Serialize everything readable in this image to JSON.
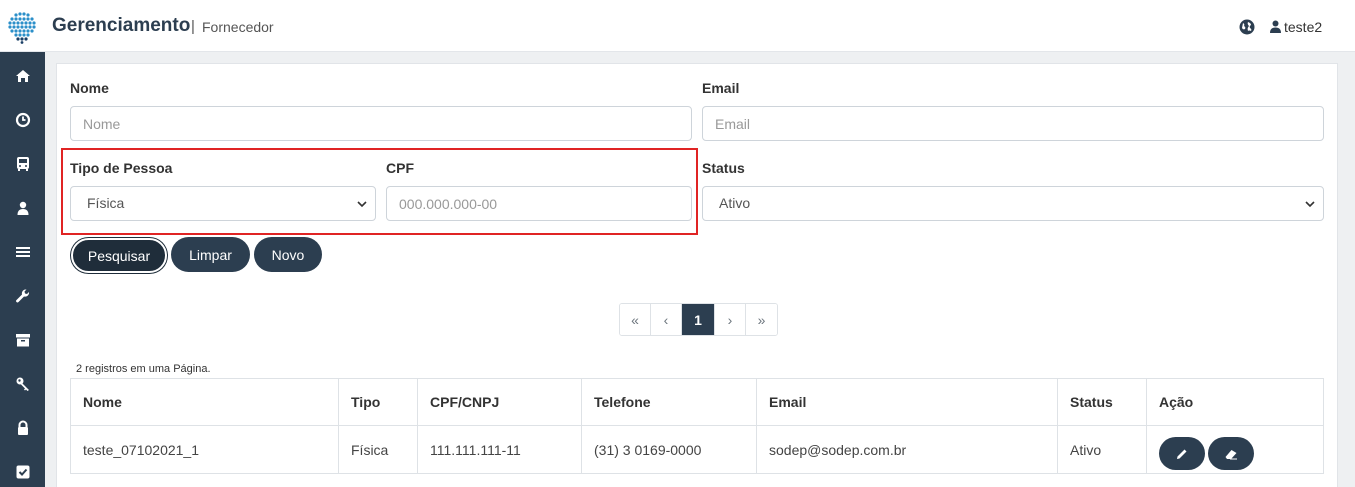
{
  "header": {
    "title": "Gerenciamento",
    "separator": "|",
    "subtitle": "Fornecedor",
    "user": "teste2"
  },
  "sidebar": {
    "items": [
      {
        "name": "home-icon"
      },
      {
        "name": "clock-icon"
      },
      {
        "name": "bus-icon"
      },
      {
        "name": "user-icon"
      },
      {
        "name": "menu-icon"
      },
      {
        "name": "wrench-icon"
      },
      {
        "name": "archive-icon"
      },
      {
        "name": "key-icon"
      },
      {
        "name": "lock-icon"
      },
      {
        "name": "checkbox-icon"
      }
    ]
  },
  "form": {
    "nome_label": "Nome",
    "nome_placeholder": "Nome",
    "email_label": "Email",
    "email_placeholder": "Email",
    "tipo_label": "Tipo de Pessoa",
    "tipo_value": "Física",
    "cpf_label": "CPF",
    "cpf_placeholder": "000.000.000-00",
    "status_label": "Status",
    "status_value": "Ativo"
  },
  "buttons": {
    "search": "Pesquisar",
    "clear": "Limpar",
    "new": "Novo"
  },
  "pagination": {
    "first": "«",
    "prev": "‹",
    "current": "1",
    "next": "›",
    "last": "»"
  },
  "records_text": "2 registros em uma Página.",
  "table": {
    "headers": [
      "Nome",
      "Tipo",
      "CPF/CNPJ",
      "Telefone",
      "Email",
      "Status",
      "Ação"
    ],
    "rows": [
      {
        "nome": "teste_07102021_1",
        "tipo": "Física",
        "doc": "111.111.111-11",
        "telefone": "(31) 3 0169-0000",
        "email": "sodep@sodep.com.br",
        "status": "Ativo"
      }
    ]
  },
  "colors": {
    "primary": "#2c3e50",
    "highlight": "#e02424"
  }
}
